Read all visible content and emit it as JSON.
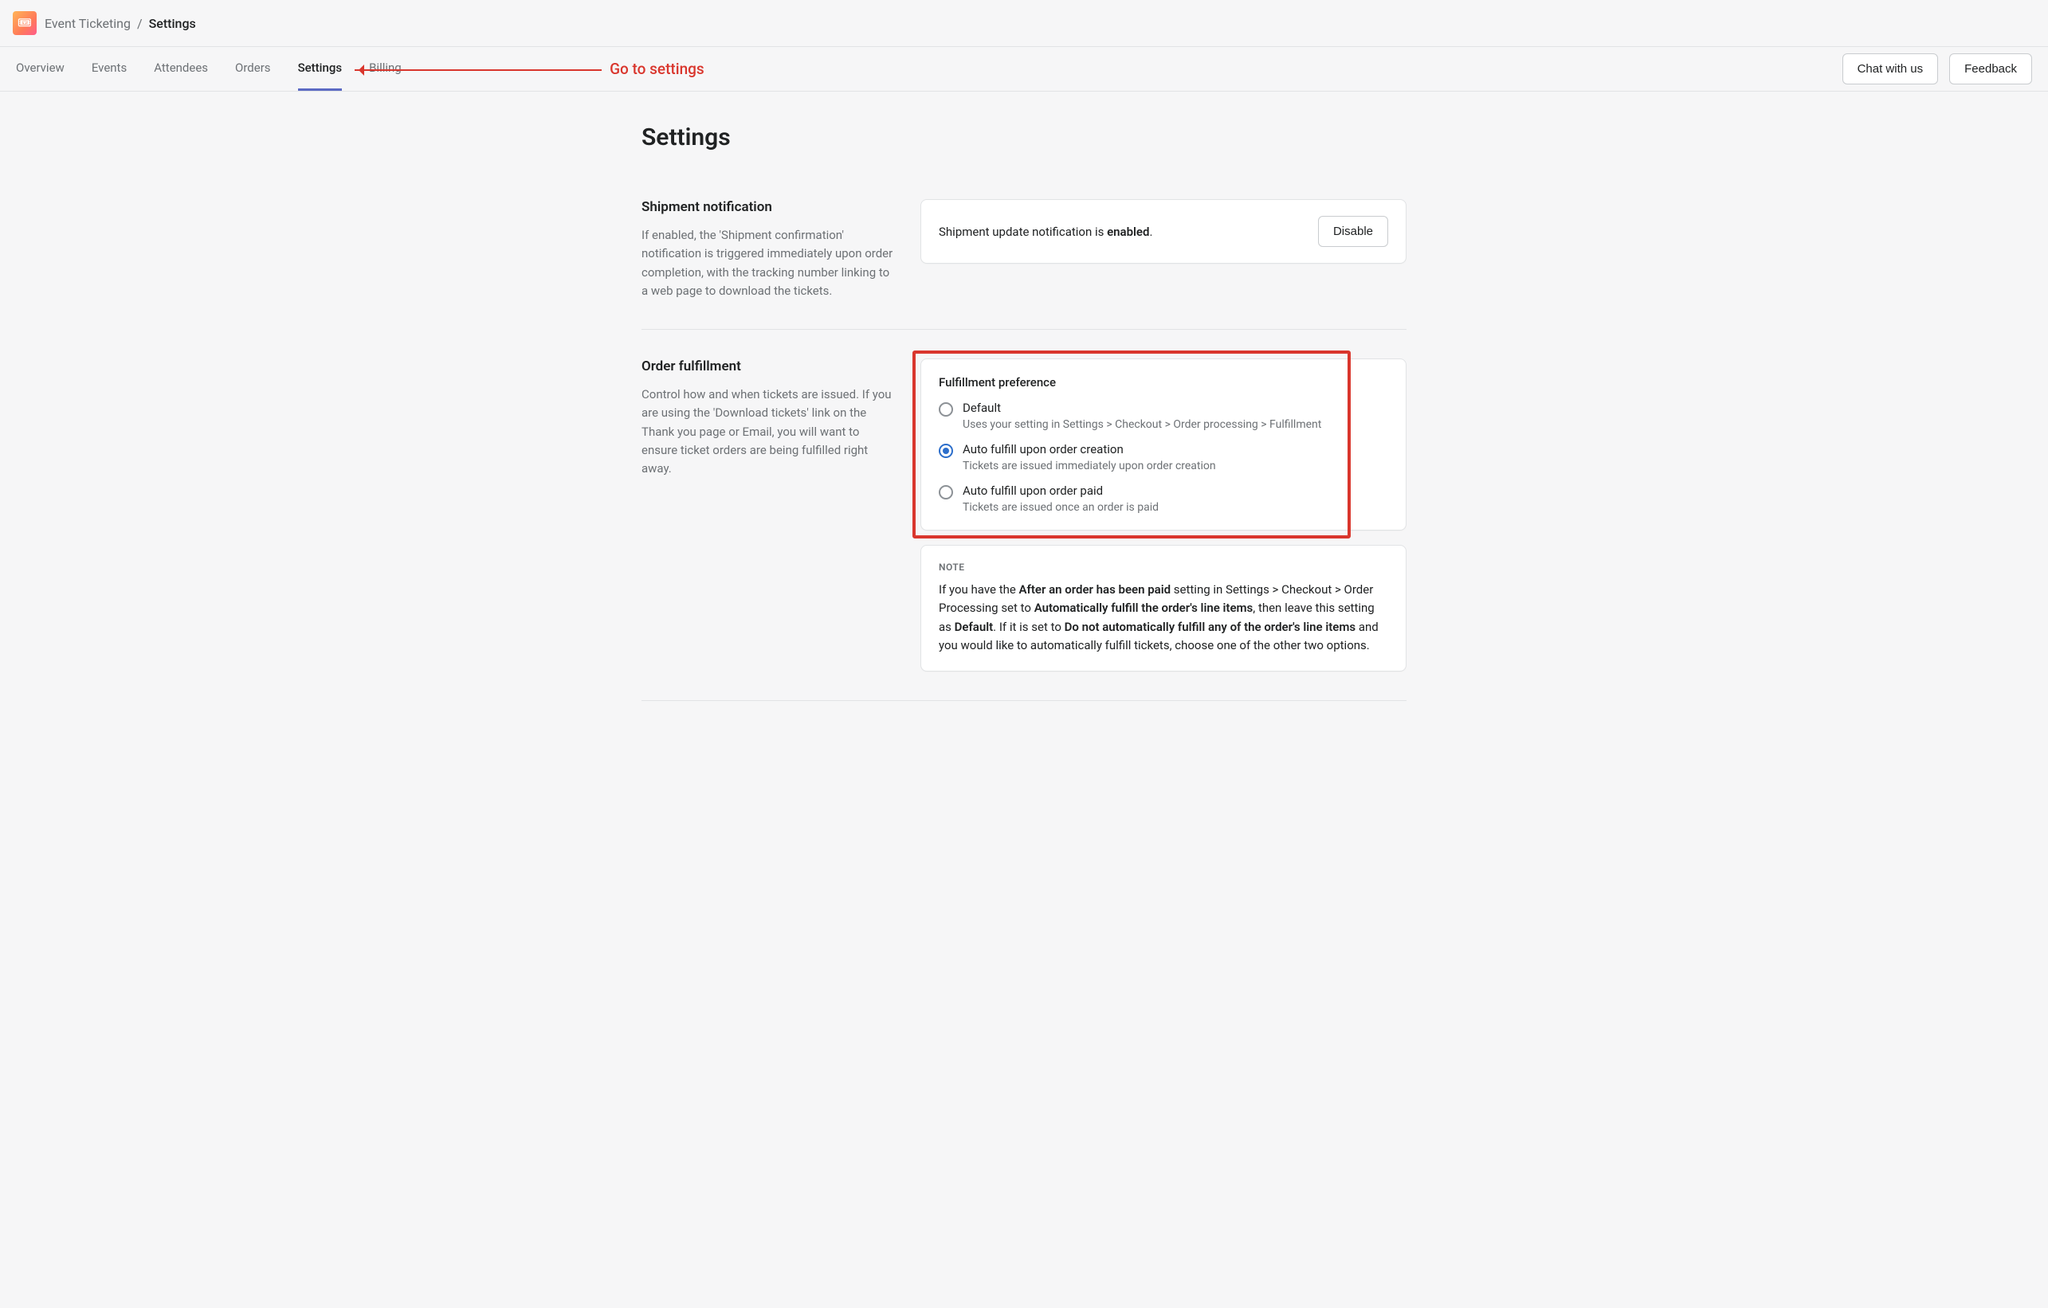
{
  "header": {
    "app_name": "Event Ticketing",
    "separator": "/",
    "page": "Settings"
  },
  "tabs": {
    "items": [
      "Overview",
      "Events",
      "Attendees",
      "Orders",
      "Settings",
      "Billing"
    ],
    "active_index": 4,
    "actions": {
      "chat": "Chat with us",
      "feedback": "Feedback"
    }
  },
  "page_title": "Settings",
  "sections": {
    "shipment": {
      "title": "Shipment notification",
      "desc": "If enabled, the 'Shipment confirmation' notification is triggered immediately upon order completion, with the tracking number linking to a web page to download the tickets.",
      "status_prefix": "Shipment update notification is ",
      "status_value": "enabled",
      "status_suffix": ".",
      "button": "Disable"
    },
    "fulfillment": {
      "title": "Order fulfillment",
      "desc": "Control how and when tickets are issued. If you are using the 'Download tickets' link on the Thank you page or Email, you will want to ensure ticket orders are being fulfilled right away.",
      "card_title": "Fulfillment preference",
      "options": [
        {
          "label": "Default",
          "desc": "Uses your setting in Settings > Checkout > Order processing > Fulfillment",
          "selected": false
        },
        {
          "label": "Auto fulfill upon order creation",
          "desc": "Tickets are issued immediately upon order creation",
          "selected": true
        },
        {
          "label": "Auto fulfill upon order paid",
          "desc": "Tickets are issued once an order is paid",
          "selected": false
        }
      ],
      "note": {
        "label": "NOTE",
        "p1a": "If you have the ",
        "p1b": "After an order has been paid",
        "p1c": " setting in Settings > Checkout > Order Processing set to ",
        "p1d": "Automatically fulfill the order's line items",
        "p1e": ", then leave this setting as ",
        "p1f": "Default",
        "p1g": ". If it is set to ",
        "p1h": "Do not automatically fulfill any of the order's line items",
        "p1i": " and you would like to automatically fulfill tickets, choose one of the other two options."
      }
    }
  },
  "annotation": {
    "label": "Go to settings"
  }
}
